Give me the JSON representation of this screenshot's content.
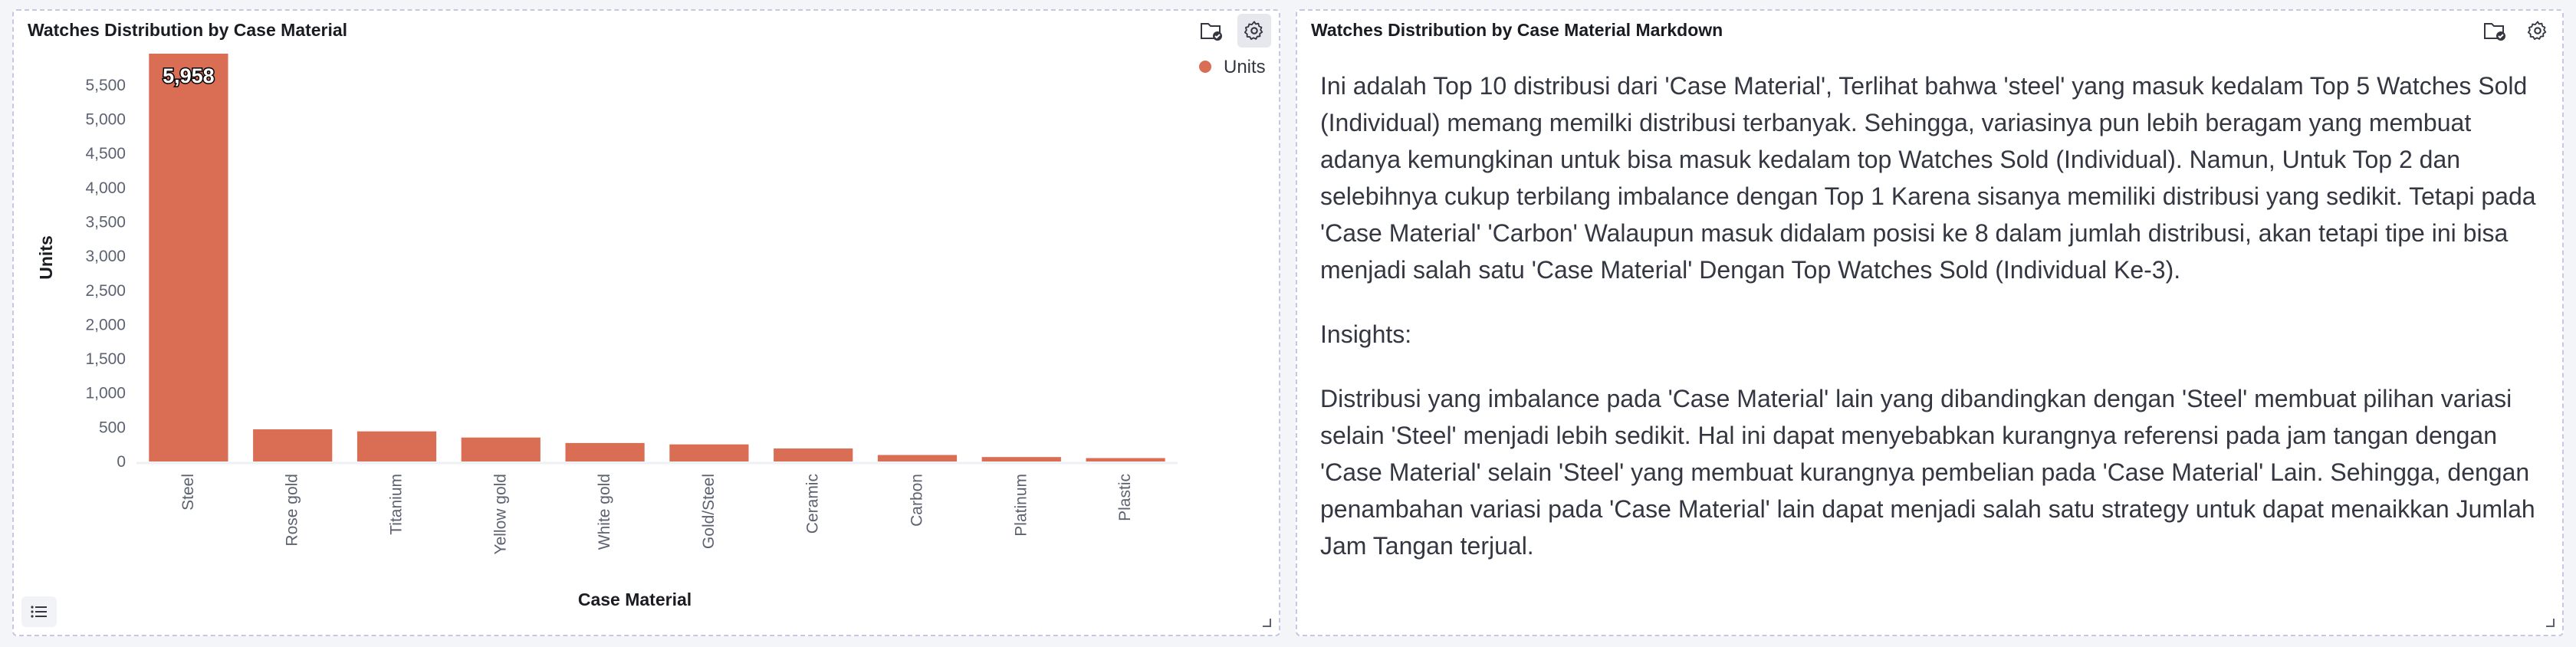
{
  "left_panel": {
    "title": "Watches Distribution by Case Material",
    "icons": [
      "folder-check-icon",
      "gear-icon",
      "list-icon",
      "resize-icon"
    ]
  },
  "right_panel": {
    "title": "Watches Distribution by Case Material Markdown",
    "icons": [
      "folder-check-icon",
      "gear-icon",
      "resize-icon"
    ],
    "paragraphs": [
      "Ini adalah Top 10 distribusi dari 'Case Material', Terlihat bahwa 'steel' yang masuk kedalam Top 5 Watches Sold (Individual) memang memilki distribusi terbanyak. Sehingga, variasinya pun lebih beragam yang membuat adanya kemungkinan untuk bisa masuk kedalam top Watches Sold (Individual). Namun, Untuk Top 2 dan selebihnya cukup terbilang imbalance dengan Top 1 Karena sisanya memiliki distribusi yang sedikit. Tetapi pada 'Case Material' 'Carbon' Walaupun masuk didalam posisi ke 8 dalam jumlah distribusi, akan tetapi tipe ini bisa menjadi salah satu 'Case Material' Dengan Top Watches Sold (Individual Ke-3).",
      "Insights:",
      "Distribusi yang imbalance pada 'Case Material' lain yang dibandingkan dengan 'Steel' membuat pilihan variasi selain 'Steel' menjadi lebih sedikit. Hal ini dapat menyebabkan kurangnya referensi pada jam tangan dengan 'Case Material' selain 'Steel' yang membuat kurangnya pembelian pada 'Case Material' Lain. Sehingga, dengan penambahan variasi pada 'Case Material' lain dapat menjadi salah satu strategy untuk dapat menaikkan Jumlah Jam Tangan terjual."
    ]
  },
  "chart_data": {
    "type": "bar",
    "categories": [
      "Steel",
      "Rose gold",
      "Titanium",
      "Yellow gold",
      "White gold",
      "Gold/Steel",
      "Ceramic",
      "Carbon",
      "Platinum",
      "Plastic"
    ],
    "series": [
      {
        "name": "Units",
        "values": [
          5958,
          470,
          440,
          350,
          270,
          250,
          190,
          95,
          65,
          50
        ]
      }
    ],
    "data_labels": [
      "5,958"
    ],
    "xlabel": "Case Material",
    "ylabel": "Units",
    "yticks": [
      "0",
      "500",
      "1,000",
      "1,500",
      "2,000",
      "2,500",
      "3,000",
      "3,500",
      "4,000",
      "4,500",
      "5,000",
      "5,500"
    ],
    "ylim": [
      0,
      5958
    ],
    "legend_position": "top-right",
    "bar_color": "#da6e55",
    "grid": false
  }
}
